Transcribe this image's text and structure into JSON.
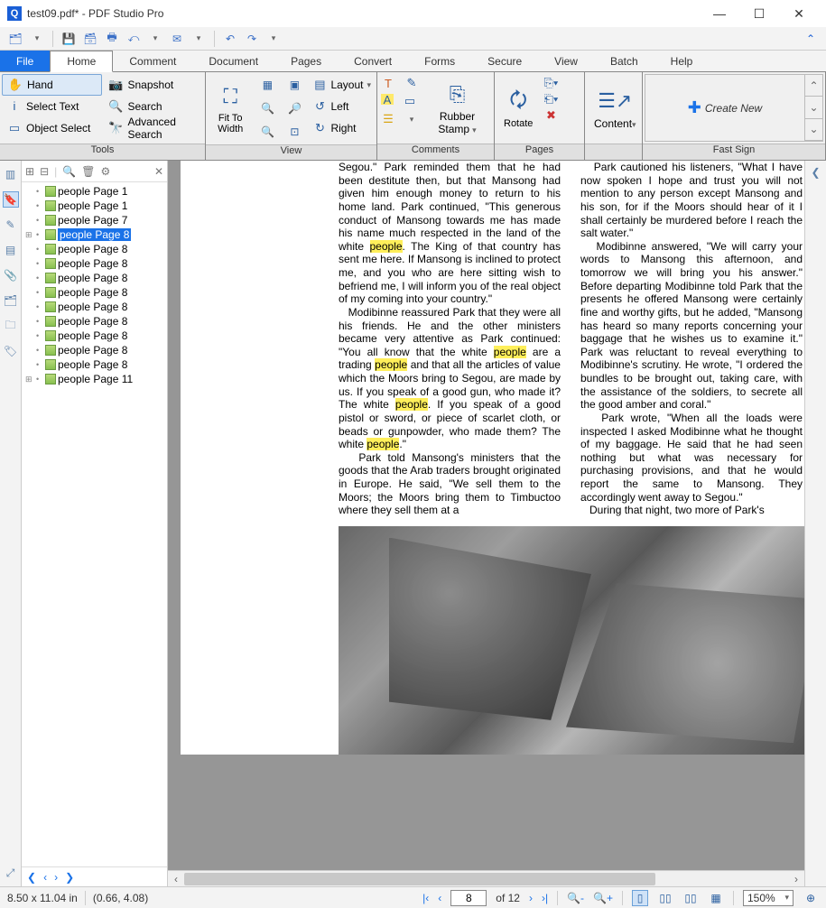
{
  "titlebar": {
    "text": "test09.pdf* - PDF Studio Pro",
    "app_icon": "Q"
  },
  "menu": {
    "file": "File",
    "home": "Home",
    "comment": "Comment",
    "document": "Document",
    "pages": "Pages",
    "convert": "Convert",
    "forms": "Forms",
    "secure": "Secure",
    "view": "View",
    "batch": "Batch",
    "help": "Help"
  },
  "ribbon": {
    "tools": {
      "label": "Tools",
      "hand": "Hand",
      "snapshot": "Snapshot",
      "select_text": "Select Text",
      "search": "Search",
      "object_select": "Object Select",
      "advanced_search": "Advanced Search"
    },
    "view": {
      "label": "View",
      "fit": "Fit To Width",
      "layout": "Layout",
      "left": "Left",
      "right": "Right"
    },
    "comments": {
      "label": "Comments",
      "stamp": "Rubber Stamp"
    },
    "pages": {
      "label": "Pages",
      "rotate": "Rotate"
    },
    "content": {
      "label": "Content"
    },
    "fastsign": {
      "label": "Fast Sign",
      "create": "Create New"
    }
  },
  "panel": {
    "items": [
      {
        "label": "people Page 1",
        "children": false
      },
      {
        "label": "people Page 1",
        "children": false
      },
      {
        "label": "people Page 7",
        "children": false
      },
      {
        "label": "people Page 8",
        "children": true,
        "selected": true
      },
      {
        "label": "people Page 8",
        "children": false
      },
      {
        "label": "people Page 8",
        "children": false
      },
      {
        "label": "people Page 8",
        "children": false
      },
      {
        "label": "people Page 8",
        "children": false
      },
      {
        "label": "people Page 8",
        "children": false
      },
      {
        "label": "people Page 8",
        "children": false
      },
      {
        "label": "people Page 8",
        "children": false
      },
      {
        "label": "people Page 8",
        "children": false
      },
      {
        "label": "people Page 8",
        "children": false
      },
      {
        "label": "people Page 11",
        "children": true
      }
    ]
  },
  "doc": {
    "col1": {
      "p1a": "Segou.\" Park reminded them that he had been destitute then, but that Mansong had given him enough money to return to his home land. Park continued, \"This generous conduct of Mansong towards me has made his name much respected in the land of the white ",
      "hl1": "people",
      "p1b": ". The King of that country has sent me here. If Mansong is inclined to protect me, and you who are here sitting wish to befriend me, I will inform you of the real object of my coming into your country.\"",
      "p2a": "Modibinne reassured Park that they were all his friends. He and the other ministers became very attentive as Park continued: \"You all know that the white ",
      "hl2": "people",
      "p2b": " are a trading ",
      "hl3": "people",
      "p2c": " and that all the articles of value which the Moors bring to Segou, are made by us. If you speak of a good gun, who made it? The white ",
      "hl4": "people",
      "p2d": ". If you speak of a good pistol or sword, or piece of scarlet cloth, or beads or gunpowder, who made them? The white ",
      "hl5": "people",
      "p2e": ".\"",
      "p3": "Park told Mansong's ministers that the goods that the Arab traders brought originated in Europe. He said, \"We sell them to the Moors; the Moors bring them to Timbuctoo where they sell them at a"
    },
    "col2": {
      "p1": "Park cautioned his listeners, \"What I have now spoken I hope and trust you will not mention to any person except Mansong and his son, for if the Moors should hear of it I shall certainly be murdered before I reach the salt water.\"",
      "p2": "Modibinne answered, \"We will carry your words to Mansong this afternoon, and tomorrow we will bring you his answer.\" Before departing Modibinne told Park that the presents he offered Mansong were certainly fine and worthy gifts, but he added, \"Mansong has heard so many reports concerning your baggage that he wishes us to examine it.\" Park was reluctant to reveal everything to Modibinne's scrutiny. He wrote, \"I ordered the bundles to be brought out, taking care, with the assistance of the soldiers, to secrete all the good amber and coral.\"",
      "p3": "Park wrote, \"When all the loads were inspected I asked Modibinne what he thought of my baggage. He said that he had seen nothing but what was necessary for purchasing provisions, and that he would report the same to Mansong. They accordingly went away to Segou.\"",
      "p4": "During that night, two more of Park's"
    }
  },
  "status": {
    "dims": "8.50 x 11.04 in",
    "coords": "(0.66, 4.08)",
    "page_current": "8",
    "page_total": "of 12",
    "zoom": "150%"
  }
}
